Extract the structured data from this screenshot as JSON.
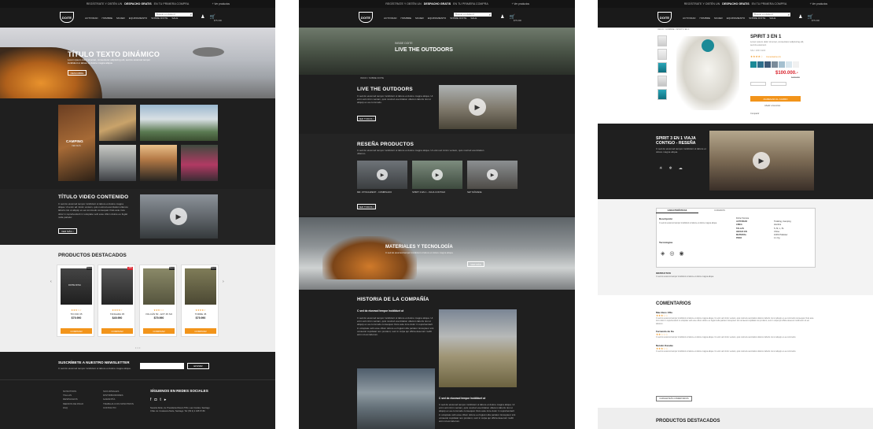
{
  "topbar": {
    "prefix": "REGÍSTRATE Y OBTÉN UN",
    "highlight": "DESPACHO GRATIS",
    "suffix": "EN TU PRIMERA COMPRA",
    "link": "+ Ver productos"
  },
  "nav": {
    "logo": "DOITE",
    "menu": [
      "ACTIVIDAD",
      "HOMBRE",
      "MUJER",
      "EQUIPAMIENTO",
      "SOBRE DOITE",
      "SALE"
    ],
    "search_placeholder": "Buscar en doite.cl",
    "sub": "$75.000"
  },
  "home": {
    "hero_title": "TÍTULO TEXTO DINÁMICO",
    "hero_text": "Lorem ipsum dolor sit amet, consectetur adipiscing elit, sed do eiusmod tempor incididunt ut labore et dolore magna aliqua.",
    "hero_button": "DESCUBRE",
    "tile_label": "CAMPING",
    "tile_sub": "VER MÁS",
    "video_title": "TÍTULO VIDEO CONTENIDO",
    "video_text": "C sed do eiusmod tempor incididunt ut labore et dolore magna aliqua. Ut enim ad minim veniam, quis nostrud exercitation ullamco laboris nisi ut aliquip ex ea commodo consequat. Duis aute irure dolor in reprehenderit in voluptate velit esse cillum dolore eu fugiat nulla pariatur.",
    "video_button": "VER MÁS >",
    "featured_title": "PRODUCTOS DESTACADOS",
    "products": [
      {
        "name": "TIO KID 35",
        "price": "$79.990",
        "stars": "★★★☆☆",
        "badge": "Nuevo",
        "color": "#2d2d2d",
        "tag": "DOITE NOVA"
      },
      {
        "name": "TANGARA 35",
        "price": "$49.990",
        "stars": "★★★★☆",
        "badge": "-40%",
        "color": "#3a3a3a",
        "tag": ""
      },
      {
        "name": "VOLCÁN 50 - EXT 45 SO",
        "price": "$79.990",
        "stars": "★★★☆☆",
        "badge": "Nuevo",
        "color": "#6b6a52",
        "tag": ""
      },
      {
        "name": "TORRE 45",
        "price": "$79.990",
        "stars": "★★★★☆",
        "badge": "Nuevo",
        "color": "#6b6a46",
        "tag": ""
      }
    ],
    "buy_label": "COMPRAR",
    "newsletter_title": "SUSCRÍBETE A NUESTRO NEWSLETTER",
    "newsletter_text": "C sed do eiusmod tempor incididunt ut labore et dolore magna aliqua.",
    "newsletter_button": "ENVIAR",
    "footer_col1": [
      "NOSOTROS",
      "TALLAS",
      "DESPACHOS",
      "MEDIOS DE PAGO",
      "FAQ"
    ],
    "footer_col2": [
      "SUCURSALES",
      "DISTRIBUIDORES",
      "GARANTÍA",
      "TRABAJA CON NOSOTROS",
      "CONTACTO"
    ],
    "social_title": "SÍGUENOS EN REDES SOCIALES",
    "address": "Nuestra Doite, Av. Presidente Riesco 5711, Las Condes, Santiago Chile. Av. Costanera Norte, Santiago. Tel: (56 2) 2 345 67 89"
  },
  "about": {
    "hero_kicker": "INSIDE DOITE",
    "hero_title": "LIVE THE OUTDOORS",
    "breadcrumb": "INICIO / SOBRE DOITE",
    "live_title": "LIVE THE OUTDOORS",
    "live_text": "C sed do eiusmod tempor incididunt ut labore et dolore magna aliqua. Ut enim ad minim veniam, quis nostrud exercitation ullamco laboris nisi ut aliquip ex ea commodo.",
    "more_button": "VER TODOS >",
    "reviews_title": "RESEÑA PRODUCTOS",
    "reviews_text": "C sed do eiusmod tempor incididunt ut labore et dolore magna aliqua. Ut enim ad minim veniam, quis nostrud exercitation ullamco.",
    "reviews": [
      "MR. ATTACHMENT - COMBINADO",
      "SPIRIT 3 EN 1 - VIAJA CONTIGO",
      "SET NÓMADE"
    ],
    "materials_title": "MATERIALES Y TECNOLOGÍA",
    "materials_text": "C sed do eiusmod tempor incididunt ut labore et dolore magna aliqua.",
    "materials_button": "VER MÁS",
    "history_title": "HISTORIA DE LA COMPAÑÍA",
    "history_sub": "C sed do eiusmod tempor incididunt ut",
    "history_text": "C sed do eiusmod tempor incididunt ut labore et dolore magna aliqua. Ut enim ad minim veniam, quis nostrud exercitation ullamco laboris nisi ut aliquip ex ea commodo consequat. Duis aute irure dolor in reprehenderit in voluptate velit esse cillum dolore eu fugiat nulla pariatur. Excepteur sint occaecat cupidatat non proident, sunt in culpa qui officia deserunt mollit anim id est laborum."
  },
  "product": {
    "breadcrumb": "INICIO / HOMBRE / SPIRIT 3 EN 1",
    "title": "SPIRIT 3 EN 1",
    "desc": "Lorem ipsum dolor sit amet, consectetur adipiscing elit, sed do eiusmod.",
    "sku": "SKU: 3357-0200",
    "stars": "★★★★☆",
    "reviews_link": "Comentarios (3)",
    "price": "$100.000.-",
    "price_old": "$139.990",
    "add_button": "AGREGAR AL CARRO",
    "wishlist": "Añadir a favoritos",
    "share": "Compartir",
    "video_title": "SPIRIT 3 EN 1 VIAJA CONTIGO - RESEÑA",
    "video_text": "C sed do eiusmod tempor incididunt ut labore et dolore magna aliqua.",
    "tab1": "CARACTERÍSTICAS",
    "tab2": "CUIDADOS",
    "desc_head": "Descripción",
    "tech_head": "Tecnologías",
    "specs": [
      [
        "Ficha Técnica",
        ""
      ],
      [
        "ACTIVIDAD",
        "Trekking, Camping"
      ],
      [
        "LINEA",
        "Hombre"
      ],
      [
        "TALLAS",
        "S, M, L, XL"
      ],
      [
        "HECHO EN",
        "China"
      ],
      [
        "MATERIAL",
        "100% Poliéster"
      ],
      [
        "PESO",
        "1.1 Kg"
      ]
    ],
    "instructions": "INSTRUCTIVO",
    "comments_title": "COMENTARIOS",
    "comments": [
      {
        "author": "Mae Bess Villa",
        "stars": "★★★☆☆"
      },
      {
        "author": "Fernando de Ka",
        "stars": "★★☆☆☆"
      },
      {
        "author": "Naruko Kasuke",
        "stars": "★★★☆☆"
      }
    ],
    "load_more": "CARGAR MÁS COMENTARIOS",
    "featured_title": "PRODUCTOS DESTACADOS"
  }
}
